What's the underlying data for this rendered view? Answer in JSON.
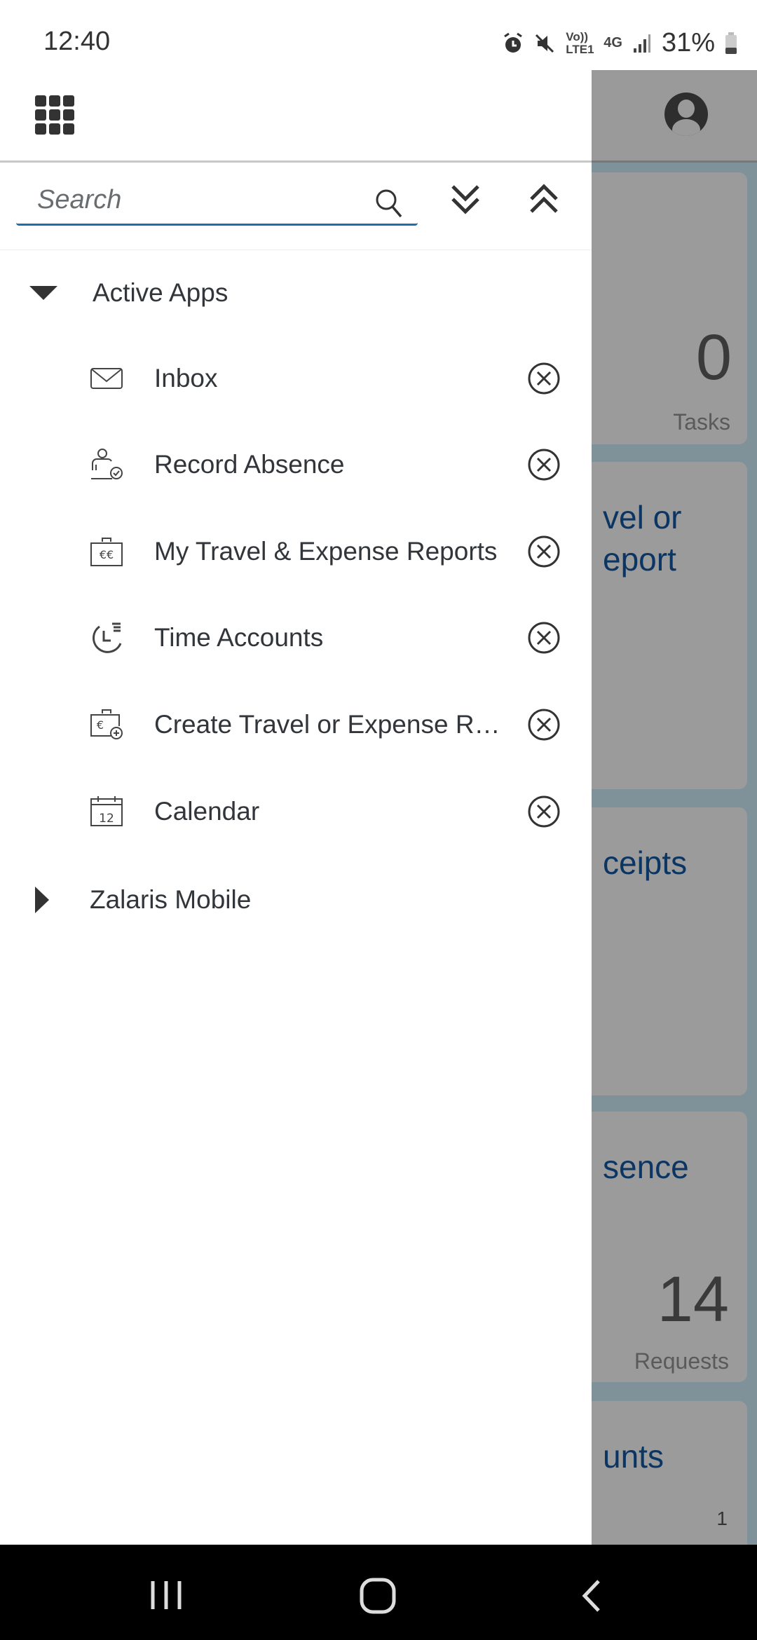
{
  "status_bar": {
    "time": "12:40",
    "net_volte": "Vo)) LTE1",
    "net_type": "4G",
    "battery": "31%"
  },
  "drawer": {
    "search": {
      "placeholder": "Search",
      "value": ""
    },
    "groups": [
      {
        "label": "Active Apps",
        "expanded": true,
        "items": [
          {
            "label": "Inbox",
            "icon": "envelope-icon"
          },
          {
            "label": "Record Absence",
            "icon": "person-check-icon"
          },
          {
            "label": "My Travel & Expense Reports",
            "icon": "briefcase-euro-icon"
          },
          {
            "label": "Time Accounts",
            "icon": "time-account-icon"
          },
          {
            "label": "Create Travel or Expense Report",
            "icon": "briefcase-euro-add-icon"
          },
          {
            "label": "Calendar",
            "icon": "calendar-icon",
            "calendar_day": "12"
          }
        ]
      },
      {
        "label": "Zalaris Mobile",
        "expanded": false
      }
    ]
  },
  "background_tiles": [
    {
      "count": "0",
      "count_label": "Tasks"
    },
    {
      "title_line1": "vel or",
      "title_line2": "eport"
    },
    {
      "title": "ceipts"
    },
    {
      "title": "sence",
      "count": "14",
      "count_label": "Requests"
    },
    {
      "title": "unts",
      "footer": "1"
    }
  ],
  "colors": {
    "accent": "#1b6fad",
    "tile_title": "#0b3563",
    "overlay": "#9a9a9a"
  }
}
